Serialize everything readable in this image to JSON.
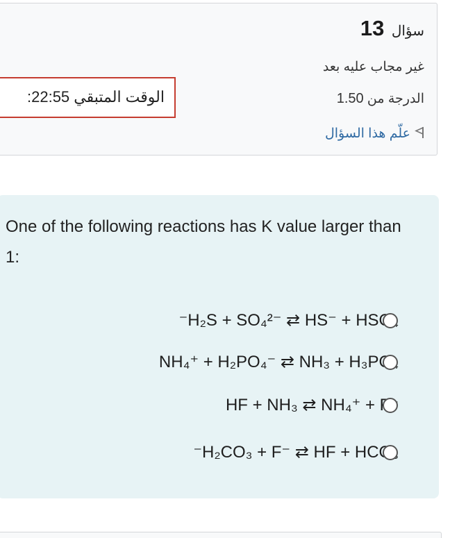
{
  "question_info": {
    "label": "سؤال",
    "number": "13",
    "status": "غير مجاب عليه بعد",
    "grade_label": "الدرجة من",
    "grade_value": "1.50",
    "flag_text": "علّم هذا السؤال"
  },
  "timer": {
    "label": "الوقت المتبقي",
    "value": "22:55:"
  },
  "question": {
    "text": "One of the following reactions has K value larger than 1:"
  },
  "answers": [
    {
      "label": "⁻H₂S + SO₄²⁻ ⇄ HS⁻ + HSO₄",
      "selected": false
    },
    {
      "label": "NH₄⁺ + H₂PO₄⁻ ⇄ NH₃ + H₃PO₄",
      "selected": false
    },
    {
      "label": "HF + NH₃ ⇄ NH₄⁺ + F⁻",
      "selected": false
    },
    {
      "label": "⁻H₂CO₃ + F⁻ ⇄ HF + HCO₃",
      "selected": false
    }
  ],
  "colors": {
    "content_background": "#e7f3f5",
    "timer_border": "#c53c2f",
    "flag_link": "#2f6aa3"
  }
}
